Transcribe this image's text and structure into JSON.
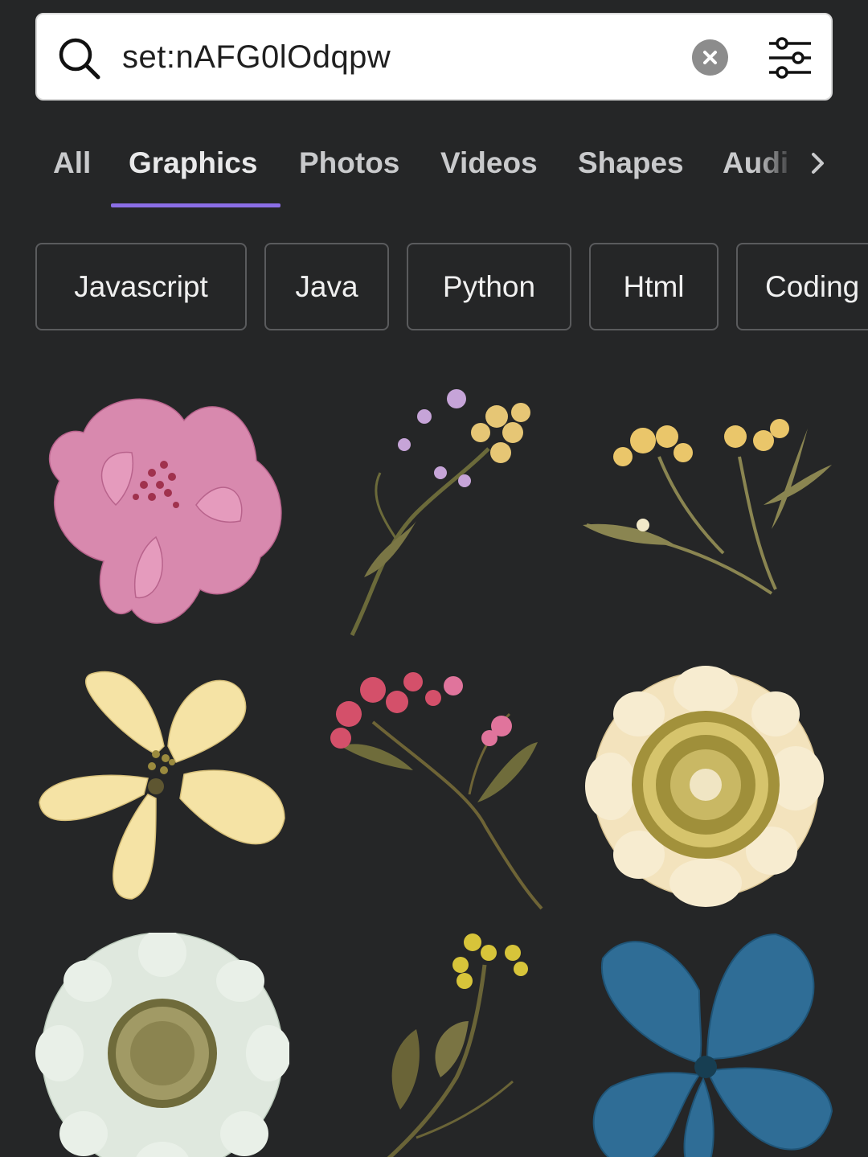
{
  "search": {
    "query": "set:nAFG0lOdqpw",
    "icon": "search-icon",
    "clear_icon": "close-icon",
    "filter_icon": "sliders-icon"
  },
  "tabs": [
    {
      "label": "All",
      "active": false
    },
    {
      "label": "Graphics",
      "active": true
    },
    {
      "label": "Photos",
      "active": false
    },
    {
      "label": "Videos",
      "active": false
    },
    {
      "label": "Shapes",
      "active": false
    },
    {
      "label": "Audi",
      "active": false
    }
  ],
  "tabs_next_icon": "chevron-right-icon",
  "chips": [
    "Javascript",
    "Java",
    "Python",
    "Html",
    "Coding"
  ],
  "results": [
    {
      "name": "pink-pressed-flower"
    },
    {
      "name": "lilac-yellow-sprig"
    },
    {
      "name": "yellow-alyssum-sprig"
    },
    {
      "name": "cream-pressed-flower"
    },
    {
      "name": "red-pink-sprig"
    },
    {
      "name": "cream-daisy-flower"
    },
    {
      "name": "white-daisy-flower"
    },
    {
      "name": "yellow-stem-sprig"
    },
    {
      "name": "blue-hydrangea-flower"
    }
  ],
  "colors": {
    "background": "#252627",
    "accent": "#8b6ee6",
    "tab_text": "#c9cacc",
    "chip_border": "#5a5b5d"
  }
}
